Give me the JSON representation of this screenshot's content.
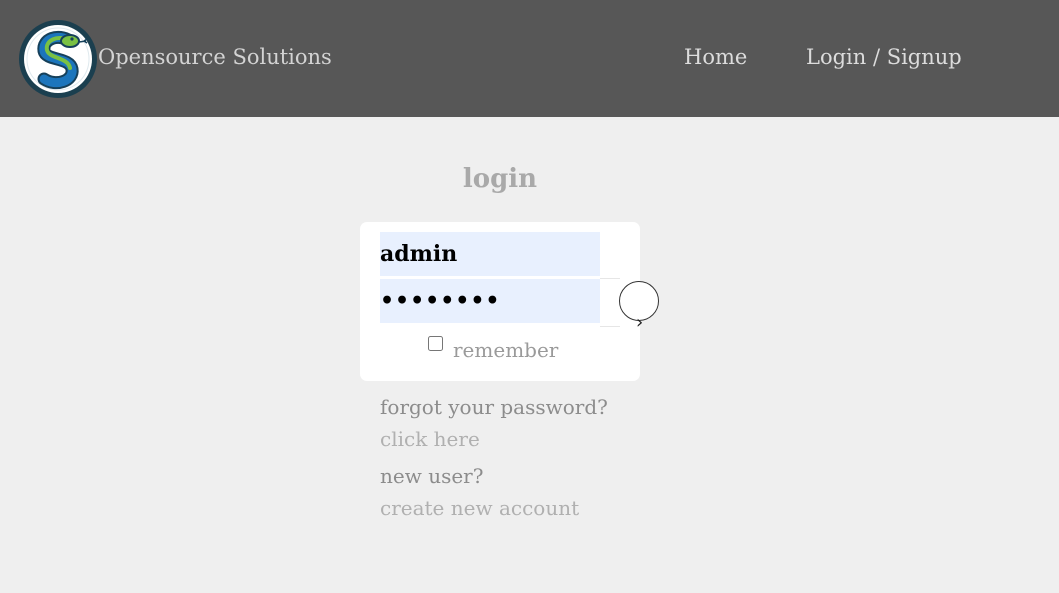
{
  "navbar": {
    "brand": "Opensource Solutions",
    "logo_icon": "snake-logo-icon",
    "links": [
      {
        "label": "Home"
      },
      {
        "label": "Login / Signup"
      }
    ],
    "background": "#575757"
  },
  "login": {
    "title": "login",
    "username_value": "admin",
    "password_value": "••••••••",
    "remember_label": "remember",
    "remember_checked": false,
    "submit_icon": "arrow-right-circle-icon"
  },
  "help": {
    "forgot_question": "forgot your password?",
    "forgot_link": "click here",
    "new_user_question": "new user?",
    "new_user_link": "create new account"
  },
  "colors": {
    "page_background": "#efefef",
    "autofill_background": "#e8f0fe",
    "snake_green": "#7ac143",
    "snake_blue": "#1c75bc"
  }
}
